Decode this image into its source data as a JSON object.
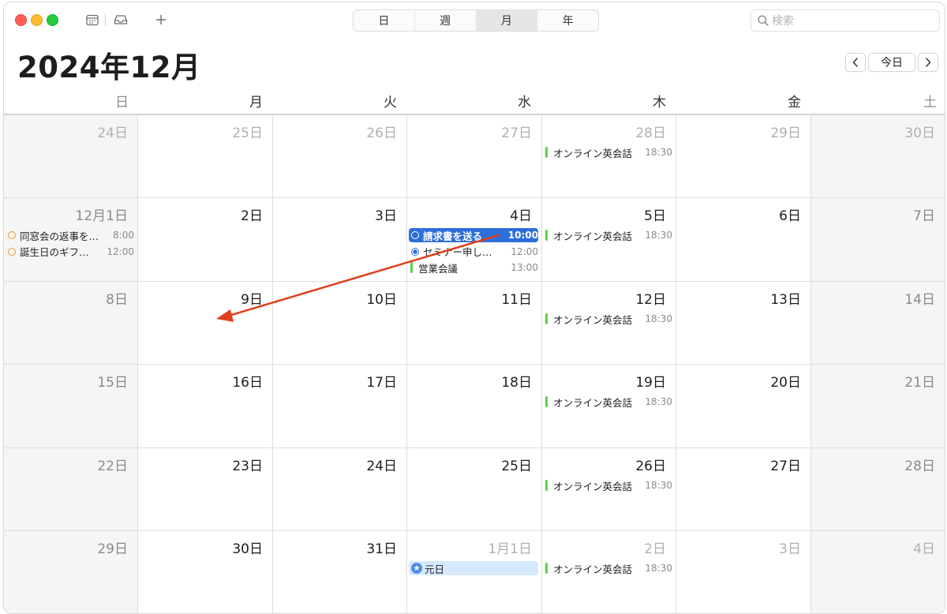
{
  "toolbar": {
    "view_buttons": [
      {
        "label": "日",
        "active": false
      },
      {
        "label": "週",
        "active": false
      },
      {
        "label": "月",
        "active": true
      },
      {
        "label": "年",
        "active": false
      }
    ],
    "search_placeholder": "検索",
    "icons": [
      "calendar-list-icon",
      "inbox-icon",
      "add-icon",
      "search-icon"
    ]
  },
  "header": {
    "title": "2024年12月",
    "today_label": "今日"
  },
  "weekdays": [
    "日",
    "月",
    "火",
    "水",
    "木",
    "金",
    "土"
  ],
  "weeks": [
    [
      {
        "day": "24日",
        "other": true,
        "events": []
      },
      {
        "day": "25日",
        "other": true,
        "events": []
      },
      {
        "day": "26日",
        "other": true,
        "events": []
      },
      {
        "day": "27日",
        "other": true,
        "events": []
      },
      {
        "day": "28日",
        "other": true,
        "events": [
          {
            "title": "オンライン英会話",
            "time": "18:30",
            "kind": "bar",
            "color": "#5fd149"
          }
        ]
      },
      {
        "day": "29日",
        "other": true,
        "events": []
      },
      {
        "day": "30日",
        "other": true,
        "events": []
      }
    ],
    [
      {
        "day": "12月1日",
        "other": false,
        "events": [
          {
            "title": "同窓会の返事を…",
            "time": "8:00",
            "kind": "ring",
            "color": "#f09a27"
          },
          {
            "title": "誕生日のギフ…",
            "time": "12:00",
            "kind": "ring",
            "color": "#f09a27"
          }
        ]
      },
      {
        "day": "2日",
        "other": false,
        "events": []
      },
      {
        "day": "3日",
        "other": false,
        "events": []
      },
      {
        "day": "4日",
        "other": false,
        "events": [
          {
            "title": "請求書を送る",
            "time": "10:00",
            "kind": "ring",
            "color": "#ffffff",
            "selected": true
          },
          {
            "title": "セミナー申し…",
            "time": "12:00",
            "kind": "ring-filled",
            "color": "#2d6fd9"
          },
          {
            "title": "営業会議",
            "time": "13:00",
            "kind": "bar",
            "color": "#5fd149"
          }
        ]
      },
      {
        "day": "5日",
        "other": false,
        "events": [
          {
            "title": "オンライン英会話",
            "time": "18:30",
            "kind": "bar",
            "color": "#5fd149"
          }
        ]
      },
      {
        "day": "6日",
        "other": false,
        "events": []
      },
      {
        "day": "7日",
        "other": false,
        "events": []
      }
    ],
    [
      {
        "day": "8日",
        "other": false,
        "events": []
      },
      {
        "day": "9日",
        "other": false,
        "events": []
      },
      {
        "day": "10日",
        "other": false,
        "events": []
      },
      {
        "day": "11日",
        "other": false,
        "events": []
      },
      {
        "day": "12日",
        "other": false,
        "events": [
          {
            "title": "オンライン英会話",
            "time": "18:30",
            "kind": "bar",
            "color": "#5fd149"
          }
        ]
      },
      {
        "day": "13日",
        "other": false,
        "events": []
      },
      {
        "day": "14日",
        "other": false,
        "events": []
      }
    ],
    [
      {
        "day": "15日",
        "other": false,
        "events": []
      },
      {
        "day": "16日",
        "other": false,
        "events": []
      },
      {
        "day": "17日",
        "other": false,
        "events": []
      },
      {
        "day": "18日",
        "other": false,
        "events": []
      },
      {
        "day": "19日",
        "other": false,
        "events": [
          {
            "title": "オンライン英会話",
            "time": "18:30",
            "kind": "bar",
            "color": "#5fd149"
          }
        ]
      },
      {
        "day": "20日",
        "other": false,
        "events": []
      },
      {
        "day": "21日",
        "other": false,
        "events": []
      }
    ],
    [
      {
        "day": "22日",
        "other": false,
        "events": []
      },
      {
        "day": "23日",
        "other": false,
        "events": []
      },
      {
        "day": "24日",
        "other": false,
        "events": []
      },
      {
        "day": "25日",
        "other": false,
        "events": []
      },
      {
        "day": "26日",
        "other": false,
        "events": [
          {
            "title": "オンライン英会話",
            "time": "18:30",
            "kind": "bar",
            "color": "#5fd149"
          }
        ]
      },
      {
        "day": "27日",
        "other": false,
        "events": []
      },
      {
        "day": "28日",
        "other": false,
        "events": []
      }
    ],
    [
      {
        "day": "29日",
        "other": false,
        "events": []
      },
      {
        "day": "30日",
        "other": false,
        "events": []
      },
      {
        "day": "31日",
        "other": false,
        "events": []
      },
      {
        "day": "1月1日",
        "other": true,
        "events": [
          {
            "title": "元日",
            "time": "",
            "kind": "holiday",
            "color": "#d6e8fb"
          }
        ]
      },
      {
        "day": "2日",
        "other": true,
        "events": [
          {
            "title": "オンライン英会話",
            "time": "18:30",
            "kind": "bar",
            "color": "#5fd149"
          }
        ]
      },
      {
        "day": "3日",
        "other": true,
        "events": []
      },
      {
        "day": "4日",
        "other": true,
        "events": []
      }
    ]
  ],
  "annotation_arrow_color": "#e0401f"
}
